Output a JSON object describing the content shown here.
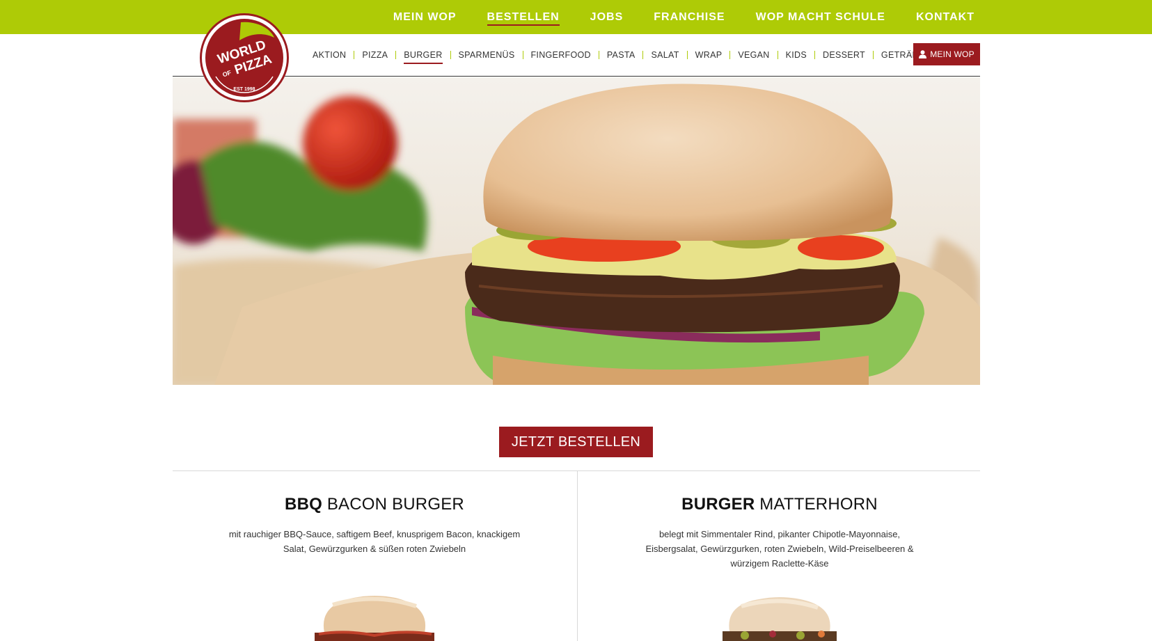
{
  "top_nav": {
    "items": [
      {
        "label": "MEIN WOP",
        "active": false
      },
      {
        "label": "BESTELLEN",
        "active": true
      },
      {
        "label": "JOBS",
        "active": false
      },
      {
        "label": "FRANCHISE",
        "active": false
      },
      {
        "label": "WOP MACHT SCHULE",
        "active": false
      },
      {
        "label": "KONTAKT",
        "active": false
      }
    ]
  },
  "logo": {
    "line1": "WORLD",
    "line2_small": "OF",
    "line2": "PIZZA",
    "est": "EST 1998"
  },
  "category_nav": {
    "items": [
      {
        "label": "AKTION",
        "active": false
      },
      {
        "label": "PIZZA",
        "active": false
      },
      {
        "label": "BURGER",
        "active": true
      },
      {
        "label": "SPARMENÜS",
        "active": false
      },
      {
        "label": "FINGERFOOD",
        "active": false
      },
      {
        "label": "PASTA",
        "active": false
      },
      {
        "label": "SALAT",
        "active": false
      },
      {
        "label": "WRAP",
        "active": false
      },
      {
        "label": "VEGAN",
        "active": false
      },
      {
        "label": "KIDS",
        "active": false
      },
      {
        "label": "DESSERT",
        "active": false
      },
      {
        "label": "GETRÄNKE",
        "active": false
      }
    ],
    "account_button": "MEIN WOP"
  },
  "hero": {
    "image": "burger-hero-photo"
  },
  "order_button": "JETZT BESTELLEN",
  "products": [
    {
      "title_bold": "BBQ",
      "title_rest": " BACON BURGER",
      "description": "mit rauchiger BBQ-Sauce, saftigem Beef, knusprigem Bacon, knackigem Salat, Gewürzgurken & süßen roten Zwiebeln"
    },
    {
      "title_bold": "BURGER",
      "title_rest": " MATTERHORN",
      "description": "belegt mit Simmentaler Rind, pikanter Chipotle-Mayonnaise, Eisbergsalat, Gewürzgurken, roten Zwiebeln, Wild-Preiselbeeren & würzigem Raclette-Käse"
    }
  ],
  "colors": {
    "brand_green": "#aecb06",
    "brand_red": "#9b1b1f"
  }
}
